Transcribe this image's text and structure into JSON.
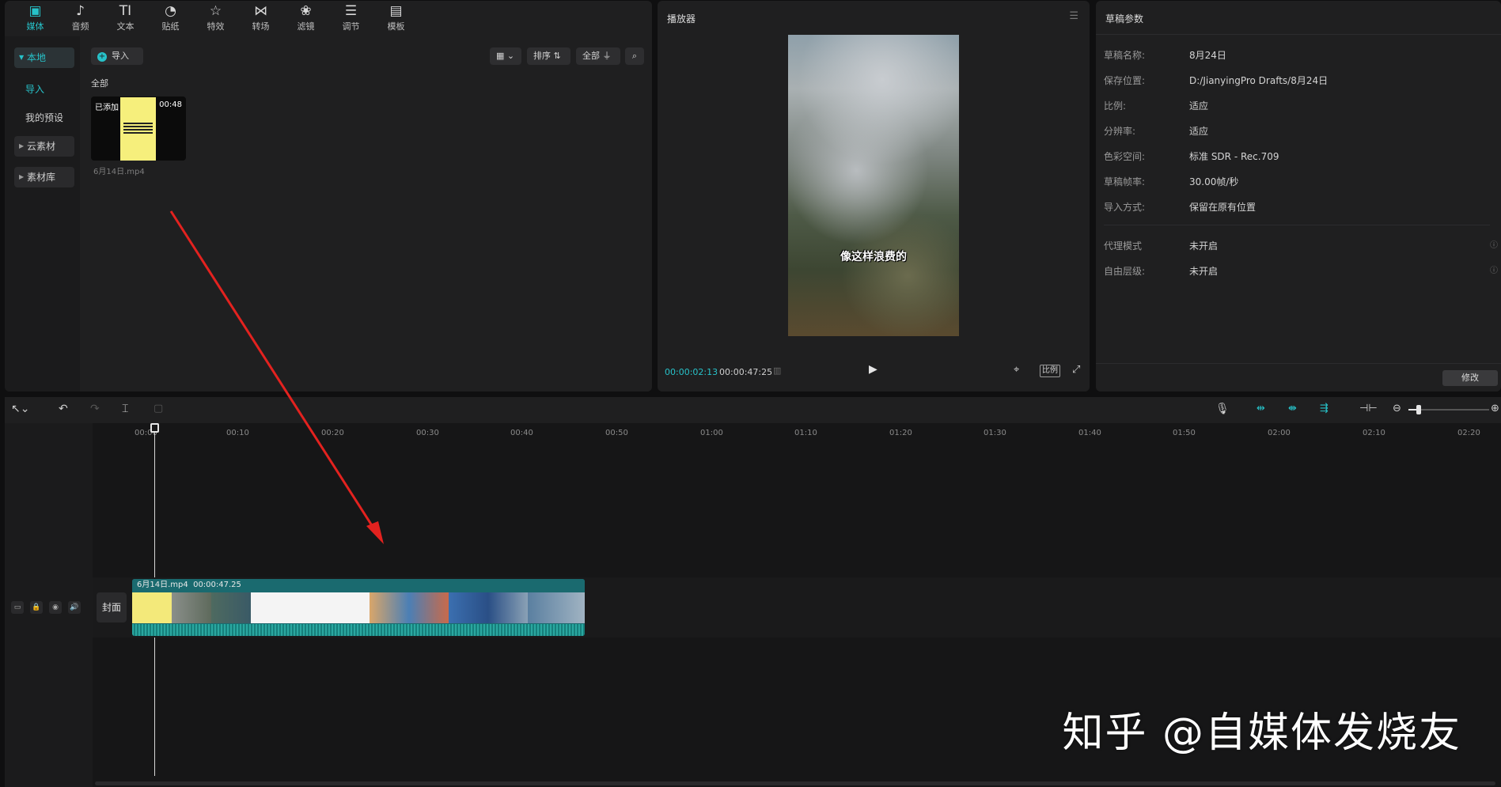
{
  "toolbar": {
    "tools": [
      {
        "label": "媒体",
        "icon": "media-icon"
      },
      {
        "label": "音频",
        "icon": "audio-icon"
      },
      {
        "label": "文本",
        "icon": "text-icon"
      },
      {
        "label": "贴纸",
        "icon": "sticker-icon"
      },
      {
        "label": "特效",
        "icon": "effects-icon"
      },
      {
        "label": "转场",
        "icon": "transition-icon"
      },
      {
        "label": "滤镜",
        "icon": "filter-icon"
      },
      {
        "label": "调节",
        "icon": "adjust-icon"
      },
      {
        "label": "模板",
        "icon": "template-icon"
      }
    ]
  },
  "media": {
    "sidebar": {
      "local": "本地",
      "import": "导入",
      "my_presets": "我的预设",
      "cloud": "云素材",
      "library": "素材库"
    },
    "import_button": "导入",
    "sort_label": "排序",
    "filter_label": "全部",
    "section_label": "全部",
    "thumb": {
      "added_badge": "已添加",
      "duration": "00:48",
      "filename": "6月14日.mp4"
    }
  },
  "player": {
    "title": "播放器",
    "subtitle": "像这样浪费的",
    "current_time": "00:00:02:13",
    "total_time": "00:00:47:25",
    "ratio_button": "比例"
  },
  "params": {
    "title": "草稿参数",
    "rows": [
      {
        "label": "草稿名称:",
        "value": "8月24日"
      },
      {
        "label": "保存位置:",
        "value": "D:/JianyingPro Drafts/8月24日"
      },
      {
        "label": "比例:",
        "value": "适应"
      },
      {
        "label": "分辨率:",
        "value": "适应"
      },
      {
        "label": "色彩空间:",
        "value": "标准 SDR - Rec.709"
      },
      {
        "label": "草稿帧率:",
        "value": "30.00帧/秒"
      },
      {
        "label": "导入方式:",
        "value": "保留在原有位置"
      }
    ],
    "extra_rows": [
      {
        "label": "代理模式",
        "value": "未开启"
      },
      {
        "label": "自由层级:",
        "value": "未开启"
      }
    ],
    "modify_button": "修改"
  },
  "timeline": {
    "ruler": [
      "00:00",
      "00:10",
      "00:20",
      "00:30",
      "00:40",
      "00:50",
      "01:00",
      "01:10",
      "01:20",
      "01:30",
      "01:40",
      "01:50",
      "02:00",
      "02:10",
      "02:20"
    ],
    "cover_label": "封面",
    "clip": {
      "name": "6月14日.mp4",
      "duration": "00:00:47.25"
    }
  },
  "watermark": "知乎 @自媒体发烧友",
  "colors": {
    "accent": "#27c2c9",
    "clip": "#1a6a6f",
    "arrow": "#e3221f"
  }
}
